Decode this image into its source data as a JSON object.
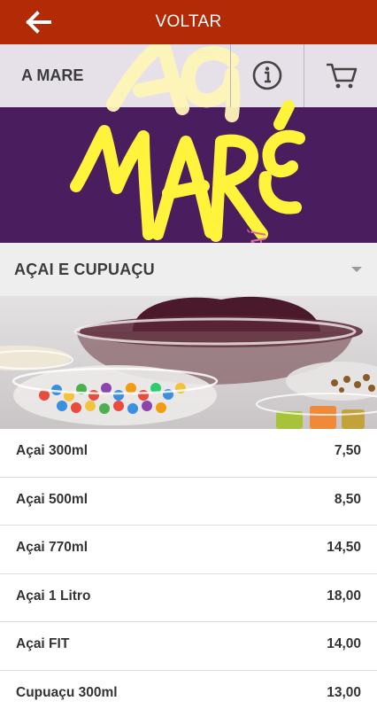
{
  "header": {
    "back_icon": "arrow-left-icon",
    "title": "VOLTAR",
    "color": "#b22a06"
  },
  "store": {
    "name": "A MARE",
    "info_icon": "info-icon",
    "cart_icon": "cart-icon",
    "logo_text": "AÇAÍ"
  },
  "category": {
    "title": "AÇAI E CUPUAÇU",
    "toggle_icon": "caret-down-icon"
  },
  "products": [
    {
      "name": "Açai 300ml",
      "price": "7,50"
    },
    {
      "name": "Açai 500ml",
      "price": "8,50"
    },
    {
      "name": "Açai 770ml",
      "price": "14,50"
    },
    {
      "name": "Açai 1 Litro",
      "price": "18,00"
    },
    {
      "name": "Açai FIT",
      "price": "14,00"
    },
    {
      "name": "Cupuaçu 300ml",
      "price": "13,00"
    }
  ]
}
